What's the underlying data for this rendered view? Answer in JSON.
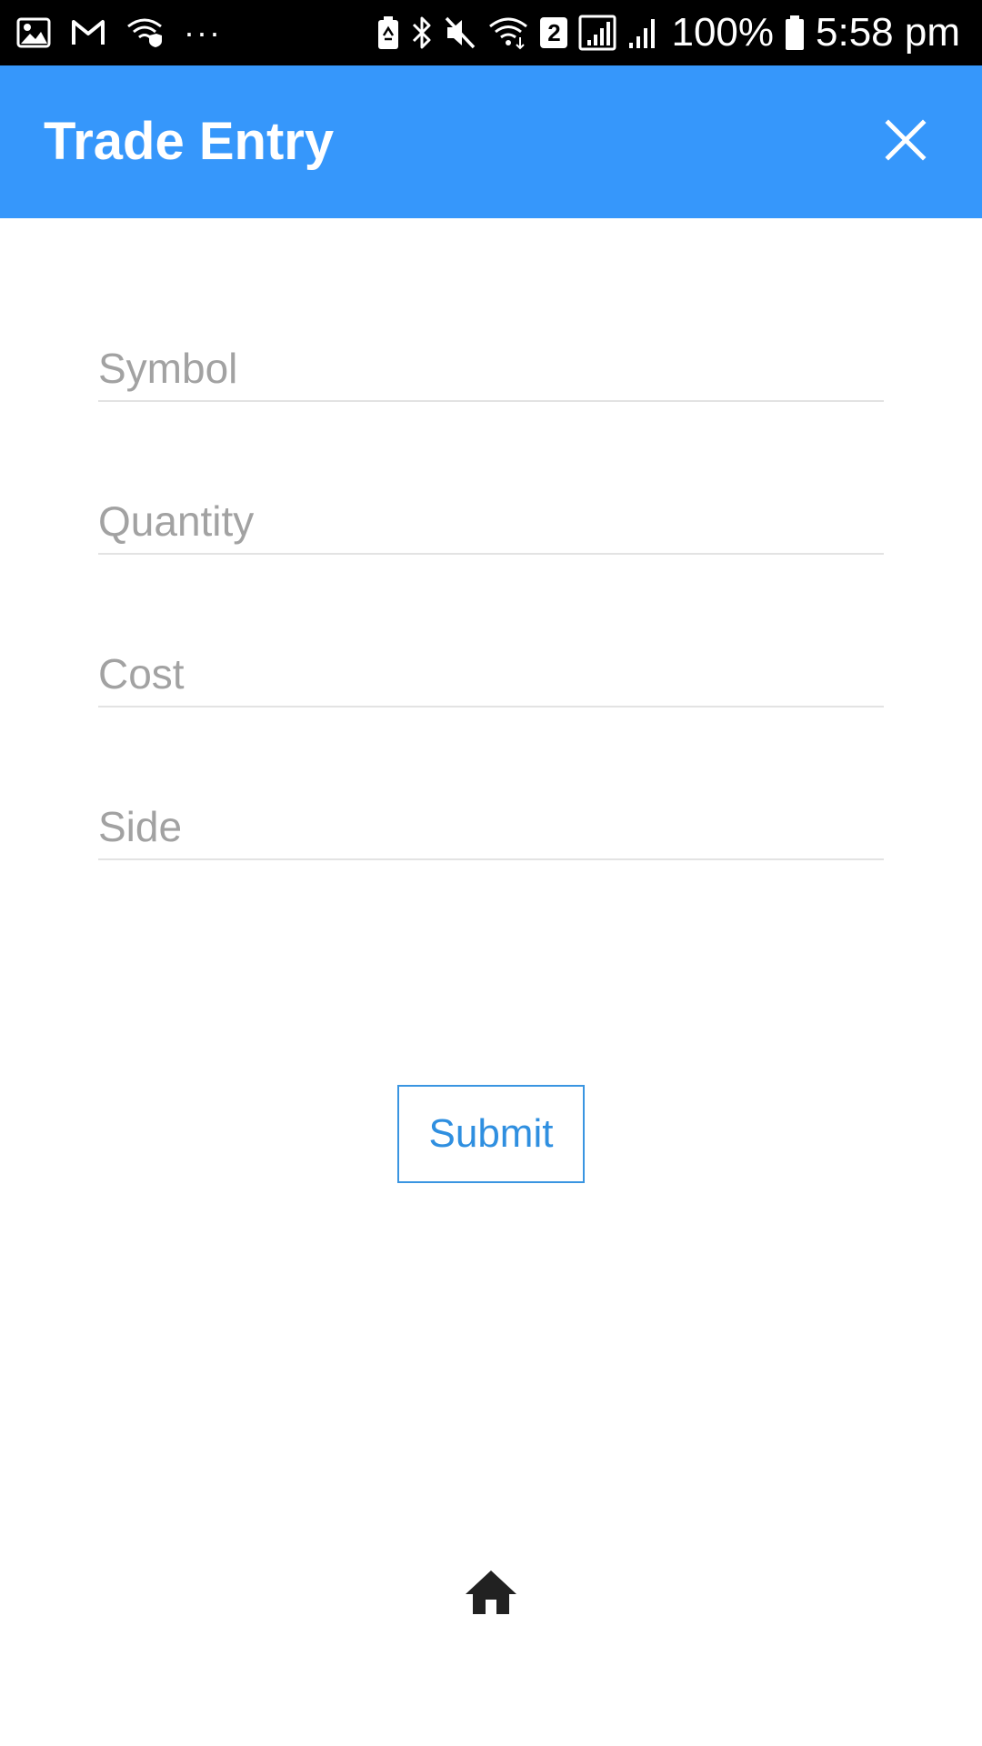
{
  "status_bar": {
    "battery_percent": "100%",
    "time": "5:58 pm",
    "sim_badge": "2",
    "more_dots": "···"
  },
  "app_bar": {
    "title": "Trade Entry",
    "background_color": "#3697fb"
  },
  "form": {
    "symbol": {
      "placeholder": "Symbol",
      "value": ""
    },
    "quantity": {
      "placeholder": "Quantity",
      "value": ""
    },
    "cost": {
      "placeholder": "Cost",
      "value": ""
    },
    "side": {
      "placeholder": "Side",
      "value": ""
    }
  },
  "submit": {
    "label": "Submit",
    "accent_color": "#3a95e1"
  },
  "icons": {
    "close": "close-icon",
    "home": "home-icon"
  }
}
